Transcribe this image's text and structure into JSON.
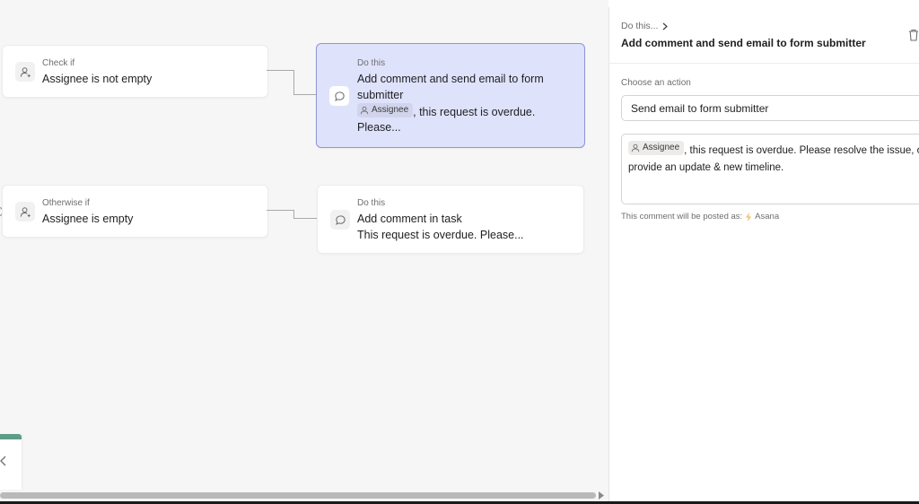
{
  "canvas": {
    "rule1": {
      "condition": {
        "prefix": "Check if",
        "text": "Assignee is not empty"
      },
      "action": {
        "prefix": "Do this",
        "title_line1": "Add comment and send email to form",
        "title_line2": "submitter",
        "chip_label": "Assignee",
        "line3_suffix": ", this request is overdue.",
        "line4": "Please..."
      }
    },
    "rule2": {
      "condition": {
        "prefix": "Otherwise if",
        "text": "Assignee is empty"
      },
      "action": {
        "prefix": "Do this",
        "title": "Add comment in task",
        "preview": "This request is overdue. Please..."
      }
    }
  },
  "panel": {
    "breadcrumb": "Do this...",
    "title": "Add comment and send email to form submitter",
    "choose_label": "Choose an action",
    "selected_action": "Send email to form submitter",
    "message": {
      "chip_label": "Assignee",
      "line1_suffix": ", this request is overdue. Please resolve the issue, or",
      "line2": "provide an update & new timeline."
    },
    "posted_as_prefix": "This comment will be posted as:",
    "posted_as_name": "Asana"
  },
  "icons": {
    "condition": "user-plus-icon",
    "action": "comment-icon",
    "chip": "user-icon",
    "trash": "trash-icon",
    "breadcrumb": "chevron-right-icon",
    "posted": "lightning-icon"
  },
  "colors": {
    "canvas_bg": "#f6f6f6",
    "selected_card_bg": "#dfe2fb",
    "selected_card_border": "#8f95d6",
    "accent_green": "#5e9c87",
    "lightning": "#f1bd6c"
  }
}
